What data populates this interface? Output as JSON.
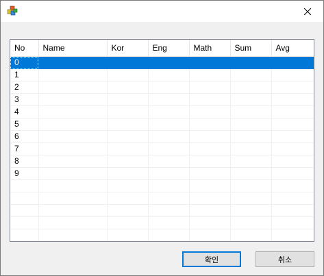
{
  "window": {
    "icon": "application-cubes-icon",
    "close_icon": "close-icon"
  },
  "list": {
    "columns": [
      "No",
      "Name",
      "Kor",
      "Eng",
      "Math",
      "Sum",
      "Avg"
    ],
    "rows": [
      [
        "0",
        "",
        "",
        "",
        "",
        "",
        ""
      ],
      [
        "1",
        "",
        "",
        "",
        "",
        "",
        ""
      ],
      [
        "2",
        "",
        "",
        "",
        "",
        "",
        ""
      ],
      [
        "3",
        "",
        "",
        "",
        "",
        "",
        ""
      ],
      [
        "4",
        "",
        "",
        "",
        "",
        "",
        ""
      ],
      [
        "5",
        "",
        "",
        "",
        "",
        "",
        ""
      ],
      [
        "6",
        "",
        "",
        "",
        "",
        "",
        ""
      ],
      [
        "7",
        "",
        "",
        "",
        "",
        "",
        ""
      ],
      [
        "8",
        "",
        "",
        "",
        "",
        "",
        ""
      ],
      [
        "9",
        "",
        "",
        "",
        "",
        "",
        ""
      ]
    ],
    "selected_row": 0,
    "empty_grid_rows": 5
  },
  "buttons": {
    "ok_label": "확인",
    "cancel_label": "취소"
  },
  "colors": {
    "selection": "#0078d7",
    "default_button_border": "#0078d7"
  }
}
